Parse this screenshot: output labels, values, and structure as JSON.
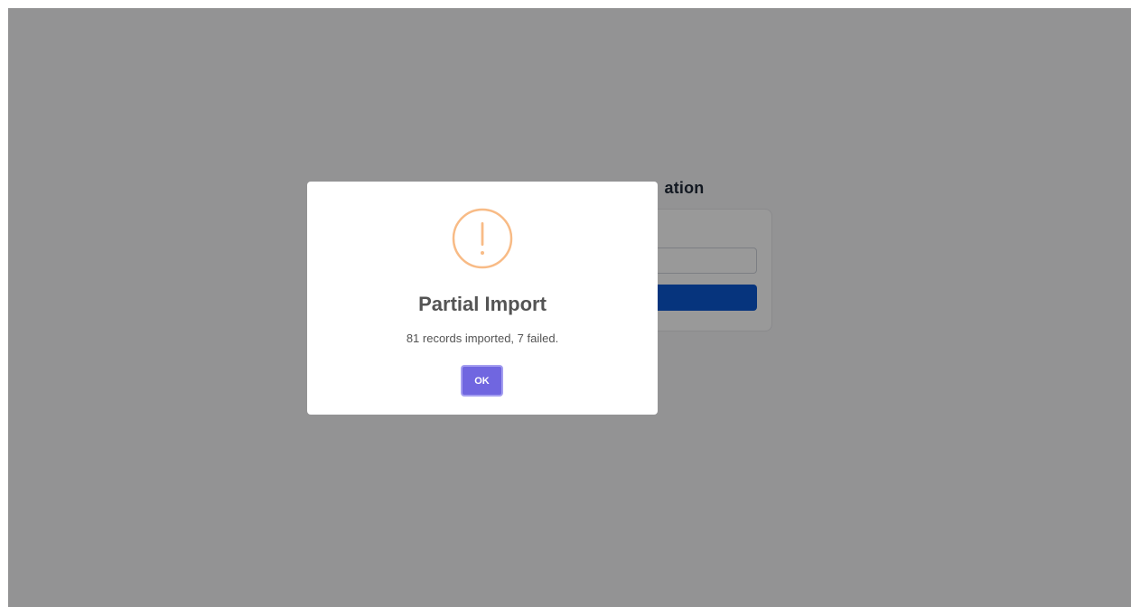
{
  "page": {
    "heading": "ation"
  },
  "modal": {
    "icon": "warning-icon",
    "icon_color": "#f8bb86",
    "title": "Partial Import",
    "message": "81 records imported, 7 failed.",
    "confirm_label": "OK",
    "confirm_color": "#7066e0"
  }
}
